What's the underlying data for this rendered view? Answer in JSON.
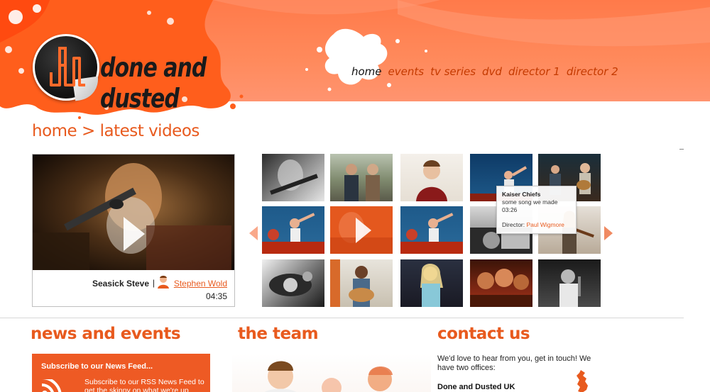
{
  "brand": {
    "name": "done and dusted",
    "logo_icon": "dd-monogram-logo",
    "accent": "#e85a1e",
    "header_orange": "#ff7a4a",
    "dark": "#111111"
  },
  "nav": {
    "items": [
      {
        "label": "home",
        "active": true
      },
      {
        "label": "events",
        "active": false
      },
      {
        "label": "tv series",
        "active": false
      },
      {
        "label": "dvd",
        "active": false
      },
      {
        "label": "director 1",
        "active": false
      },
      {
        "label": "director 2",
        "active": false
      }
    ]
  },
  "breadcrumb": "home > latest videos",
  "featured": {
    "artist": "Seasick Steve",
    "separator": "|",
    "director": "Stephen Wold",
    "duration": "04:35",
    "play_icon": "play-icon"
  },
  "thumbnails": [
    {
      "name": "thumb-guitarist-bw"
    },
    {
      "name": "thumb-two-men-hills"
    },
    {
      "name": "thumb-man-red-jacket"
    },
    {
      "name": "thumb-band-stage-blue"
    },
    {
      "name": "thumb-duo-guitars-stage"
    },
    {
      "name": "thumb-band-stage-red"
    },
    {
      "name": "thumb-orange-selected"
    },
    {
      "name": "thumb-band-stage-red-2"
    },
    {
      "name": "thumb-car-bw"
    },
    {
      "name": "thumb-violinist"
    },
    {
      "name": "thumb-car-driver-bw"
    },
    {
      "name": "thumb-acoustic-guitarist"
    },
    {
      "name": "thumb-singer-blonde"
    },
    {
      "name": "thumb-band-red-light"
    },
    {
      "name": "thumb-singer-mic-bw"
    }
  ],
  "tooltip": {
    "title": "Kaiser Chiefs",
    "subtitle": "some song we made",
    "duration": "03:26",
    "director_label": "Director:",
    "director_name": "Paul Wigmore"
  },
  "news": {
    "title": "news and events",
    "subscribe": "Subscribe to our News Feed...",
    "text": "Subscribe to our RSS News Feed to get the skinny on what we're up",
    "rss_icon": "rss-icon"
  },
  "team": {
    "title": "the team"
  },
  "contact": {
    "title": "contact us",
    "text": "We'd love to hear from you, get in touch! We have two offices:",
    "office": "Done and Dusted UK",
    "map_icon": "uk-map-icon"
  }
}
